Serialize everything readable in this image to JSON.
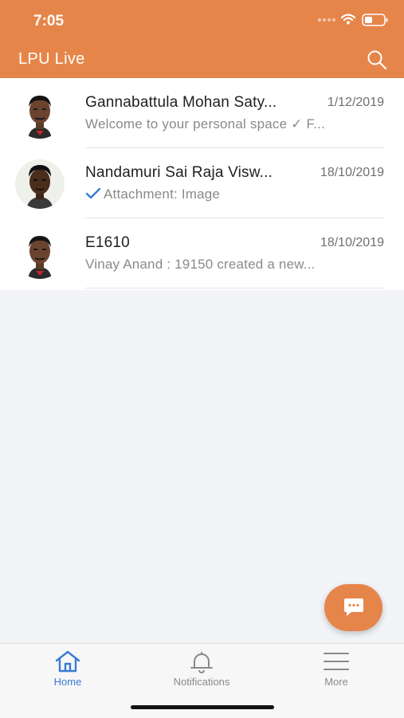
{
  "status_bar": {
    "time": "7:05"
  },
  "header": {
    "title": "LPU Live",
    "search_icon": "search-icon"
  },
  "colors": {
    "brand": "#e6854a",
    "tab_active": "#3b7bd6",
    "tab_inactive": "#8a8a8a"
  },
  "chats": [
    {
      "name": "Gannabattula Mohan Saty...",
      "date": "1/12/2019",
      "preview": "Welcome to your personal space ✓ F...",
      "read_tick": false
    },
    {
      "name": "Nandamuri Sai Raja Visw...",
      "date": "18/10/2019",
      "preview": "Attachment: Image",
      "read_tick": true
    },
    {
      "name": "E1610",
      "date": "18/10/2019",
      "preview": "Vinay Anand : 19150 created a new...",
      "read_tick": false
    }
  ],
  "fab": {
    "icon": "chat-bubble-icon"
  },
  "tabs": [
    {
      "label": "Home",
      "icon": "home-icon",
      "active": true
    },
    {
      "label": "Notifications",
      "icon": "bell-icon",
      "active": false
    },
    {
      "label": "More",
      "icon": "menu-icon",
      "active": false
    }
  ]
}
